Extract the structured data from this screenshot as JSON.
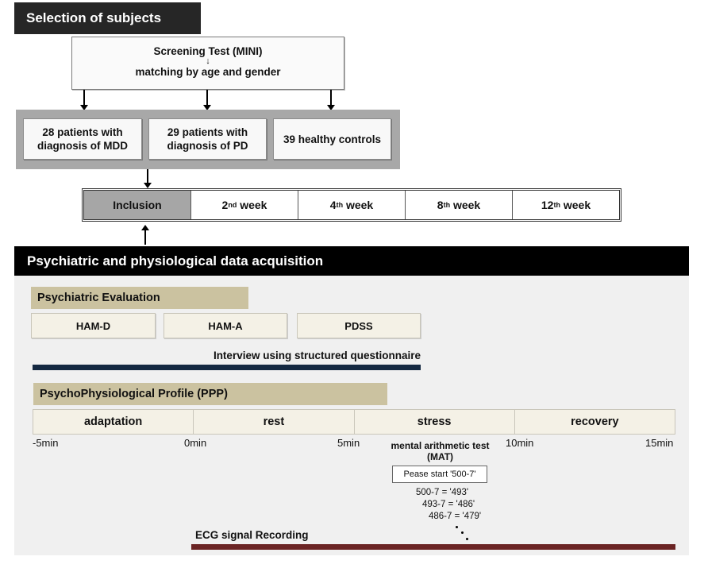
{
  "selection": {
    "header": "Selection of subjects",
    "screening": {
      "line1": "Screening Test (MINI)",
      "arrow": "↓",
      "line2": "matching by age and gender"
    },
    "groups": [
      {
        "line1": "28 patients with",
        "line2": "diagnosis of MDD"
      },
      {
        "line1": "29 patients with",
        "line2": "diagnosis of PD"
      },
      {
        "line1": "39 healthy controls",
        "line2": ""
      }
    ],
    "timeline": [
      {
        "num": "",
        "sup": "",
        "label": "Inclusion"
      },
      {
        "num": "2",
        "sup": "nd",
        "label": " week"
      },
      {
        "num": "4",
        "sup": "th",
        "label": " week"
      },
      {
        "num": "8",
        "sup": "th",
        "label": " week"
      },
      {
        "num": "12",
        "sup": "th",
        "label": " week"
      }
    ]
  },
  "acquisition": {
    "header": "Psychiatric and physiological data acquisition",
    "psychiatric": {
      "header": "Psychiatric Evaluation",
      "scales": [
        "HAM-D",
        "HAM-A",
        "PDSS"
      ],
      "interview_label": "Interview using structured questionnaire"
    },
    "ppp": {
      "header": "PsychoPhysiological Profile (PPP)",
      "phases": [
        "adaptation",
        "rest",
        "stress",
        "recovery"
      ],
      "ticks": [
        "-5min",
        "0min",
        "5min",
        "10min",
        "15min"
      ],
      "mat": {
        "label_line1": "mental arithmetic test",
        "label_line2": "(MAT)",
        "prompt": "Pease start '500-7'",
        "calculations": [
          "500-7 = '493'",
          "493-7 = '486'",
          "486-7 = '479'"
        ]
      },
      "ecg_label": "ECG signal Recording"
    }
  },
  "colors": {
    "dark_header": "#262626",
    "black_header": "#000000",
    "tan_header": "#cbc2a0",
    "box_fill": "#f4f1e6",
    "interview_bar": "#142841",
    "ecg_bar": "#6b2424",
    "group_gray": "#a8a8a8",
    "inclusion_gray": "#a6a6a6"
  }
}
